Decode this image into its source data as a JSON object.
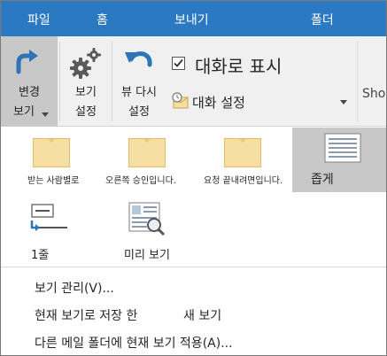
{
  "tabs": [
    "파일",
    "홈",
    "보내기",
    "폴더"
  ],
  "ribbon": {
    "change_view_line1": "변경",
    "change_view_line2": "보기",
    "view_settings_line1": "보기",
    "view_settings_line2": "설정",
    "reset_view_line1": "뷰 다시",
    "reset_view_line2": "설정",
    "show_as_conversations": "대화로 표시",
    "show_as_conversations_checked": true,
    "conversation_settings": "대화 설정",
    "truncated_next": "Sho"
  },
  "gallery": {
    "items": [
      {
        "label": "받는 사람별로",
        "icon": "envelope-icon"
      },
      {
        "label": "오른쪽 승인입니다.",
        "icon": "envelope-icon"
      },
      {
        "label": "요청 끝내려면입니다.",
        "icon": "envelope-icon"
      },
      {
        "label": "좁게",
        "icon": "compact-list-icon",
        "selected": true
      },
      {
        "label": "1줄",
        "icon": "single-line-icon"
      },
      {
        "label": "미리 보기",
        "icon": "preview-icon"
      }
    ]
  },
  "menu": {
    "manage_views": "보기 관리(V)...",
    "save_current_view": "현재 보기로 저장 한",
    "new_view": "새 보기",
    "apply_to_other_folders": "다른 메일 폴더에 현재 보기 적용(A)..."
  },
  "colors": {
    "tab_bar": "#2b79c2",
    "ribbon_bg": "#f0f0f0",
    "selected_bg": "#c8c8c8",
    "icon_blue": "#2e75b6",
    "envelope": "#f7dea3"
  }
}
